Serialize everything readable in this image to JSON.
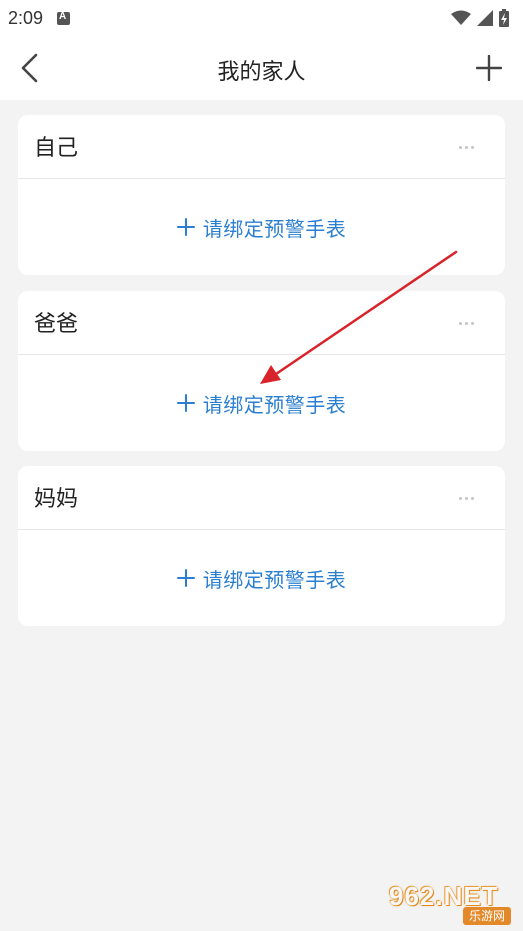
{
  "status_bar": {
    "time": "2:09",
    "notification_icon": "a-notification-icon",
    "icons": [
      "wifi-icon",
      "cellular-signal-icon",
      "battery-charging-icon"
    ]
  },
  "nav": {
    "title": "我的家人",
    "back_icon": "chevron-left-icon",
    "add_icon": "plus-icon"
  },
  "members": [
    {
      "name": "自己",
      "bind_label": "请绑定预警手表"
    },
    {
      "name": "爸爸",
      "bind_label": "请绑定预警手表"
    },
    {
      "name": "妈妈",
      "bind_label": "请绑定预警手表"
    }
  ],
  "colors": {
    "accent": "#2c7fd0",
    "background": "#f3f3f3",
    "card": "#ffffff",
    "annotation_arrow": "#d9232a"
  },
  "watermark": {
    "main": "962.NET",
    "sub": "乐游网"
  }
}
